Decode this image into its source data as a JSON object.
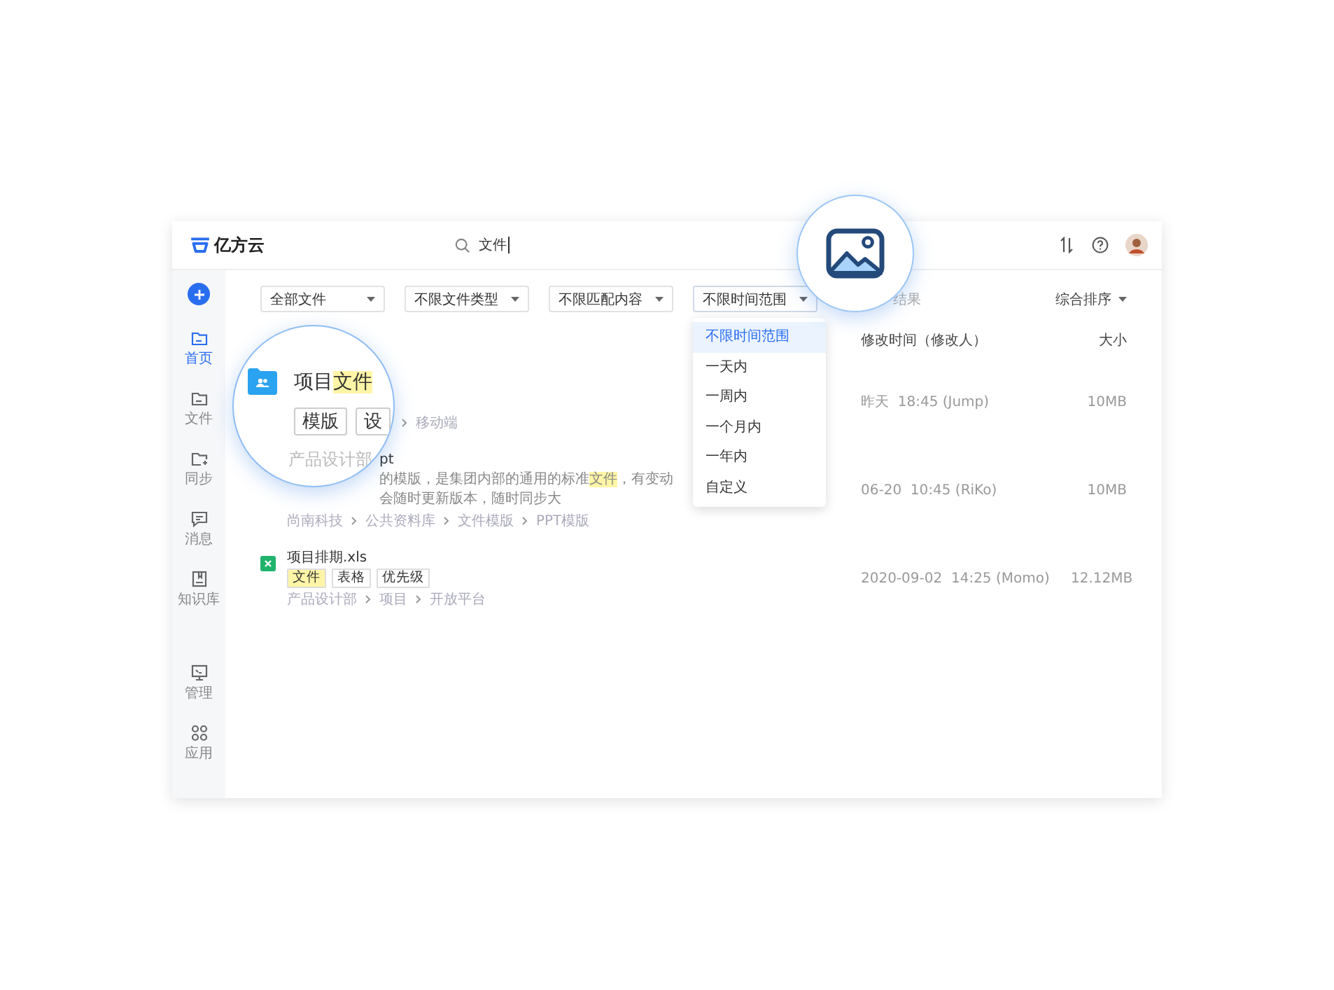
{
  "app": {
    "logo": "亿方云"
  },
  "search": {
    "value": "文件"
  },
  "sidebar": {
    "items": [
      {
        "label": "首页",
        "selected": true
      },
      {
        "label": "文件",
        "selected": false
      },
      {
        "label": "同步",
        "selected": false
      },
      {
        "label": "消息",
        "selected": false
      },
      {
        "label": "知识库",
        "selected": false
      }
    ],
    "bottom_items": [
      {
        "label": "管理",
        "selected": false
      },
      {
        "label": "应用",
        "selected": false
      }
    ]
  },
  "filters": [
    {
      "label": "全部文件",
      "expanded": false
    },
    {
      "label": "不限文件类型",
      "expanded": false
    },
    {
      "label": "不限匹配内容",
      "expanded": false
    },
    {
      "label": "不限时间范围",
      "expanded": true
    }
  ],
  "dropdown": {
    "options": [
      {
        "label": "不限时间范围",
        "selected": true
      },
      {
        "label": "一天内",
        "selected": false
      },
      {
        "label": "一周内",
        "selected": false
      },
      {
        "label": "一个月内",
        "selected": false
      },
      {
        "label": "一年内",
        "selected": false
      },
      {
        "label": "自定义",
        "selected": false
      }
    ]
  },
  "results_label": "结果",
  "sort": "综合排序",
  "columns": {
    "modified": "修改时间（修改人）",
    "size": "大小"
  },
  "rows": [
    {
      "kind": "folder",
      "path": [
        "移动端"
      ],
      "time": "昨天  18:45 (Jump)",
      "size": "10MB"
    },
    {
      "kind": "presentation",
      "name": "pt",
      "desc": [
        {
          "text": "的模版，是集团内部的通用的标准",
          "highlight": false
        },
        {
          "text": "文件",
          "highlight": true
        },
        {
          "text": "，有变动会随时更新版本，随时同步大",
          "highlight": false
        }
      ],
      "path": [
        "尚南科技",
        "公共资料库",
        "文件模版",
        "PPT模版"
      ],
      "time": "06-20  10:45 (RiKo)",
      "size": "10MB"
    },
    {
      "kind": "spreadsheet",
      "name": "项目排期.xls",
      "tags": [
        {
          "text": "文件",
          "highlight": true
        },
        {
          "text": "表格",
          "highlight": false
        },
        {
          "text": "优先级",
          "highlight": false
        }
      ],
      "path": [
        "产品设计部",
        "项目",
        "开放平台"
      ],
      "time": "2020-09-02  14:25 (Momo)",
      "size": "12.12MB"
    }
  ],
  "magnifier": {
    "name": [
      {
        "text": "项目",
        "highlight": false
      },
      {
        "text": "文件",
        "highlight": true
      }
    ],
    "tags": [
      "模版",
      "设"
    ],
    "path": "产品设计部"
  }
}
